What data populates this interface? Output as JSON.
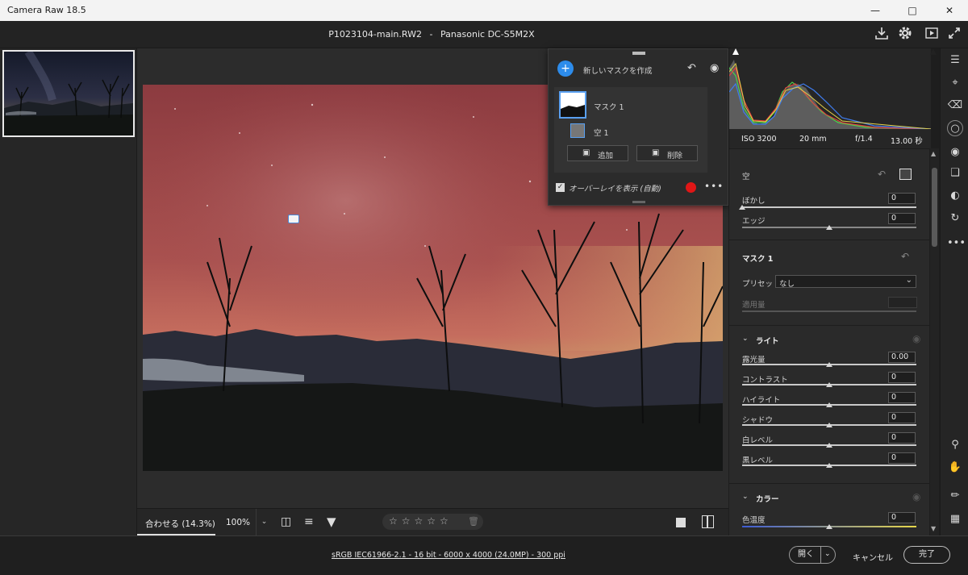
{
  "window": {
    "title": "Camera Raw 18.5"
  },
  "header": {
    "filename": "P1023104-main.RW2",
    "separator": "-",
    "camera": "Panasonic DC-S5M2X"
  },
  "mask_panel": {
    "create_label": "新しいマスクを作成",
    "mask_name": "マスク 1",
    "component_name": "空 1",
    "add_label": "追加",
    "subtract_label": "削除",
    "overlay_label": "オーバーレイを表示 (自動)",
    "overlay_checked": true,
    "overlay_color": "#e01616"
  },
  "exif": {
    "iso": "ISO 3200",
    "focal": "20 mm",
    "aperture": "f/1.4",
    "shutter": "13.00 秒"
  },
  "sky_section": {
    "title": "空",
    "feather_label": "ぼかし",
    "feather_value": "0",
    "edge_label": "エッジ",
    "edge_value": "0"
  },
  "mask_section": {
    "title": "マスク 1",
    "preset_label": "プリセット",
    "preset_value": "なし",
    "amount_label": "適用量"
  },
  "light_section": {
    "title": "ライト",
    "sliders": [
      {
        "label": "露光量",
        "value": "0.00"
      },
      {
        "label": "コントラスト",
        "value": "0"
      },
      {
        "label": "ハイライト",
        "value": "0"
      },
      {
        "label": "シャドウ",
        "value": "0"
      },
      {
        "label": "白レベル",
        "value": "0"
      },
      {
        "label": "黒レベル",
        "value": "0"
      }
    ]
  },
  "color_section": {
    "title": "カラー",
    "temp_label": "色温度",
    "temp_value": "0"
  },
  "bottom_toolbar": {
    "fit_label": "合わせる (14.3%)",
    "zoom_label": "100%",
    "rating_stars": 5
  },
  "footer": {
    "info": "sRGB IEC61966-2.1 - 16 bit - 6000 x 4000 (24.0MP) - 300 ppi",
    "open_label": "開く",
    "cancel_label": "キャンセル",
    "done_label": "完了"
  }
}
